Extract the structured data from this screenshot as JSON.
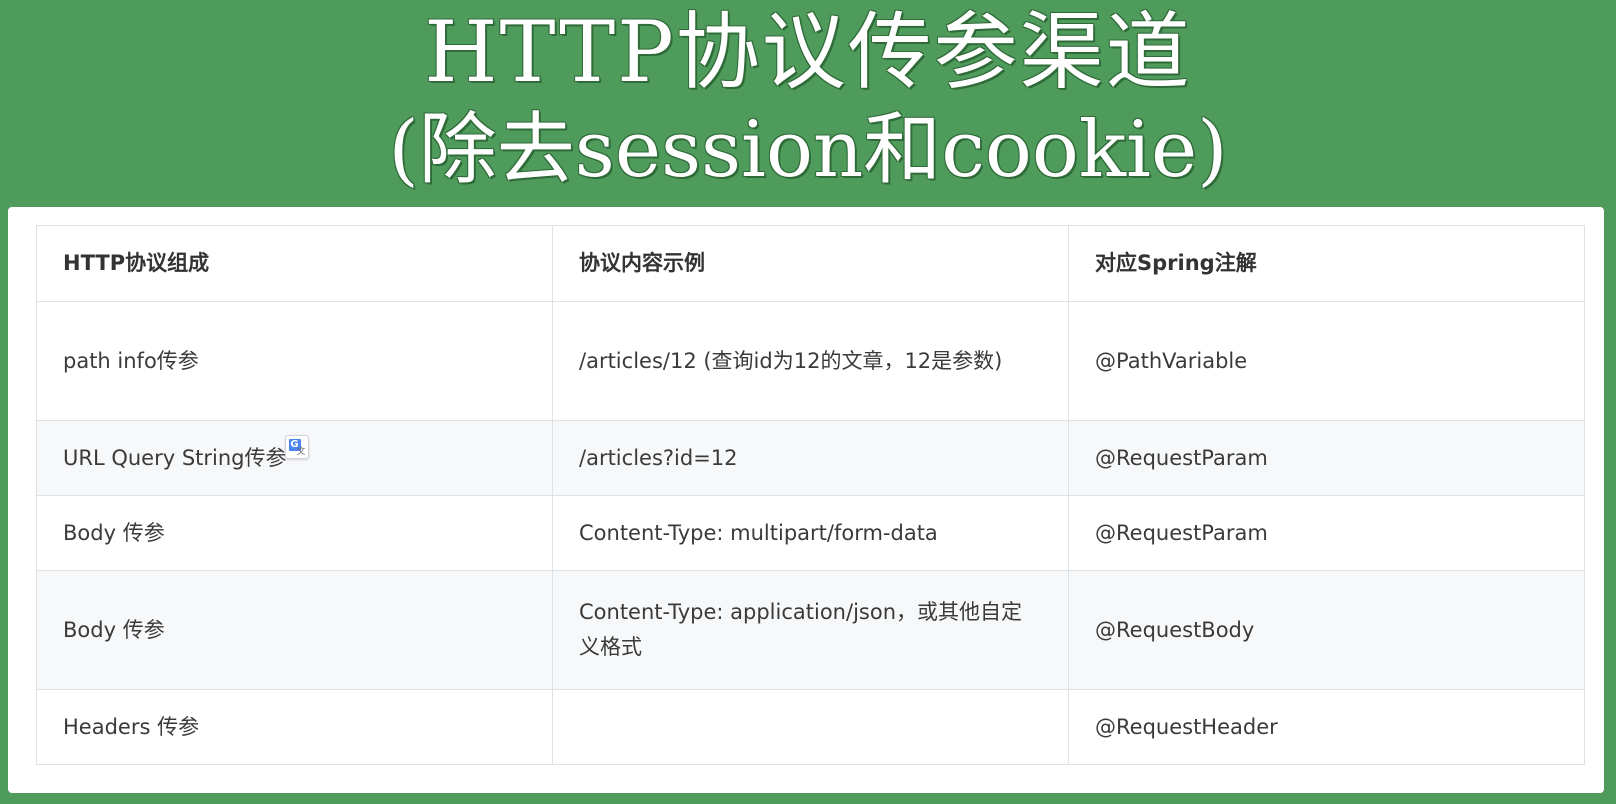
{
  "title": {
    "line1": "HTTP协议传参渠道",
    "line2": "(除去session和cookie)"
  },
  "table": {
    "headers": [
      "HTTP协议组成",
      "协议内容示例",
      "对应Spring注解"
    ],
    "rows": [
      [
        "path info传参",
        "/articles/12 (查询id为12的文章，12是参数)",
        "@PathVariable"
      ],
      [
        "URL Query String传参",
        "/articles?id=12",
        "@RequestParam"
      ],
      [
        "Body 传参",
        "Content-Type: multipart/form-data",
        "@RequestParam"
      ],
      [
        "Body 传参",
        "Content-Type: application/json，或其他自定义格式",
        "@RequestBody"
      ],
      [
        "Headers 传参",
        "",
        "@RequestHeader"
      ]
    ]
  },
  "icons": {
    "translate_popup": "translate-icon"
  },
  "colors": {
    "background": "#4f9b5b",
    "panel": "#ffffff",
    "stripe": "#f6f8fa",
    "border": "#dfe2e5"
  }
}
